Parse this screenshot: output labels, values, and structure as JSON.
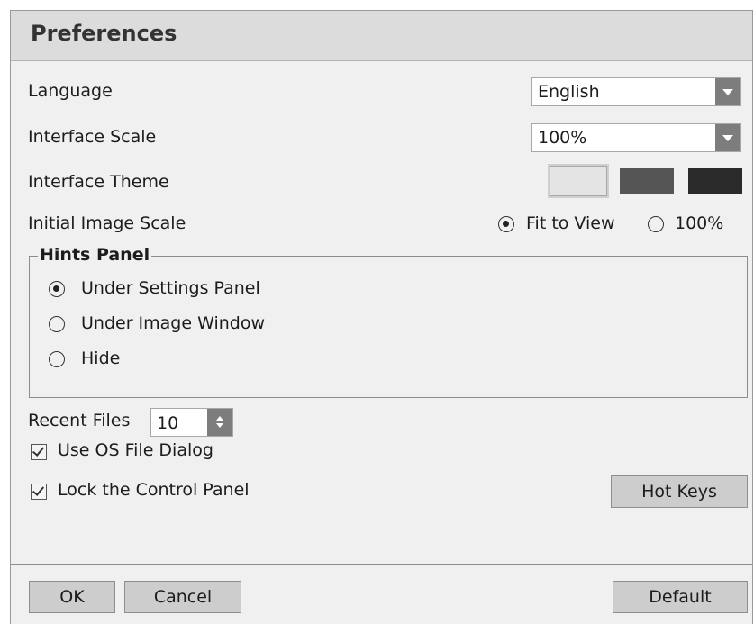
{
  "dialog": {
    "title": "Preferences"
  },
  "language": {
    "label": "Language",
    "value": "English"
  },
  "interface_scale": {
    "label": "Interface Scale",
    "value": "100%"
  },
  "interface_theme": {
    "label": "Interface Theme",
    "options": [
      {
        "color": "#e4e4e4",
        "border": "#a8a8a8",
        "selected": true
      },
      {
        "color": "#555555",
        "border": "#555555",
        "selected": false
      },
      {
        "color": "#2a2a2a",
        "border": "#2a2a2a",
        "selected": false
      }
    ]
  },
  "initial_image_scale": {
    "label": "Initial Image Scale",
    "options": [
      {
        "label": "Fit to View",
        "selected": true
      },
      {
        "label": "100%",
        "selected": false
      }
    ]
  },
  "hints_panel": {
    "title": "Hints Panel",
    "options": [
      {
        "label": "Under Settings Panel",
        "selected": true
      },
      {
        "label": "Under Image Window",
        "selected": false
      },
      {
        "label": "Hide",
        "selected": false
      }
    ]
  },
  "recent_files": {
    "label": "Recent Files",
    "value": "10"
  },
  "use_os_file_dialog": {
    "label": "Use OS File Dialog",
    "checked": true
  },
  "lock_control_panel": {
    "label": "Lock the Control Panel",
    "checked": true
  },
  "buttons": {
    "hot_keys": "Hot Keys",
    "ok": "OK",
    "cancel": "Cancel",
    "default": "Default"
  }
}
